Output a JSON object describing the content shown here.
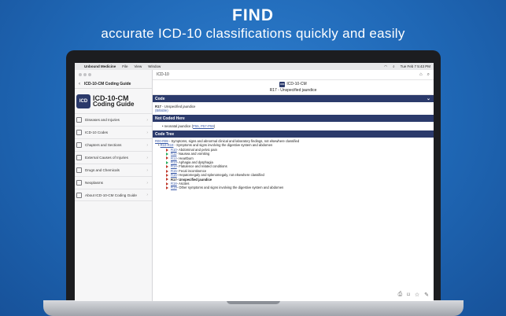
{
  "promo": {
    "headline": "FIND",
    "subline": "accurate ICD-10 classifications quickly and easily"
  },
  "menubar": {
    "apple": "",
    "app": "Unbound Medicine",
    "items": [
      "File",
      "View",
      "Window"
    ],
    "clock": "Tue Feb 7  5:43 PM"
  },
  "sidebar": {
    "back": "‹",
    "title": "ICD-10-CM Coding Guide",
    "logo_badge": "ICD",
    "logo_line1": "ICD-10-CM",
    "logo_line2": "Coding Guide",
    "items": [
      {
        "label": "Diseases and Injuries"
      },
      {
        "label": "ICD-10 Codes"
      },
      {
        "label": "Chapters and Sections"
      },
      {
        "label": "External Causes of Injuries"
      },
      {
        "label": "Drugs and Chemicals"
      },
      {
        "label": "Neoplasms"
      },
      {
        "label": "About ICD-10-CM Coding Guide"
      }
    ]
  },
  "main": {
    "toolbar_title": "ICD-10",
    "title_badge": "ICD",
    "title": "ICD-10-CM",
    "subtitle": "R17 - Unspecified jaundice",
    "code_section": {
      "heading": "Code",
      "code": "R17",
      "desc": " - Unspecified jaundice",
      "sub": "(Billable)"
    },
    "not_coded": {
      "heading": "Not Coded Here",
      "text": "neonatal jaundice (",
      "links": "P55, P57-P59",
      "close": ")"
    },
    "tree": {
      "heading": "Code Tree",
      "l0_link": "R00-R99",
      "l0_text": " - Symptoms, signs and abnormal clinical and laboratory findings, not elsewhere classified",
      "l1_link": "R10-R19",
      "l1_text": " - Symptoms and signs involving the digestive system and abdomen",
      "items": [
        {
          "code": "R10",
          "text": " - Abdominal and pelvic pain"
        },
        {
          "code": "R11",
          "text": " - Nausea and vomiting"
        },
        {
          "code": "R12",
          "text": " - Heartburn"
        },
        {
          "code": "R13",
          "text": " - Aphagia and dysphagia"
        },
        {
          "code": "R14",
          "text": " - Flatulence and related conditions"
        },
        {
          "code": "R15",
          "text": " - Fecal incontinence"
        },
        {
          "code": "R16",
          "text": " - Hepatomegaly and splenomegaly, not elsewhere classified"
        },
        {
          "code": "R17",
          "text": " - Unspecified jaundice"
        },
        {
          "code": "R18",
          "text": " - Ascites"
        },
        {
          "code": "R19",
          "text": " - Other symptoms and signs involving the digestive system and abdomen"
        }
      ]
    }
  },
  "colors": {
    "bg": "#1f67b5",
    "header_bar": "#2b3a6b",
    "link": "#3a5aa8"
  }
}
